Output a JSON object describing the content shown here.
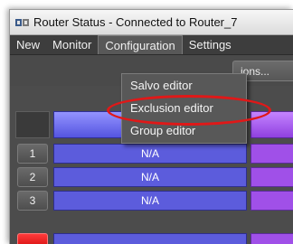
{
  "window": {
    "title": "Router Status - Connected to Router_7",
    "icon": "app-icon"
  },
  "menubar": {
    "items": [
      {
        "label": "New"
      },
      {
        "label": "Monitor"
      },
      {
        "label": "Configuration"
      },
      {
        "label": "Settings"
      }
    ]
  },
  "toolbar": {
    "partial_button_label": "ions..."
  },
  "dropdown": {
    "items": [
      {
        "label": "Salvo editor"
      },
      {
        "label": "Exclusion editor"
      },
      {
        "label": "Group editor"
      }
    ]
  },
  "grid": {
    "rows": [
      {
        "number": "1",
        "source": "N/A"
      },
      {
        "number": "2",
        "source": "N/A"
      },
      {
        "number": "3",
        "source": "N/A"
      }
    ]
  },
  "colors": {
    "highlight": "#e01818",
    "column_blue": "#5c5cdc",
    "column_purple": "#a050e8",
    "alert_red": "#d40000"
  }
}
